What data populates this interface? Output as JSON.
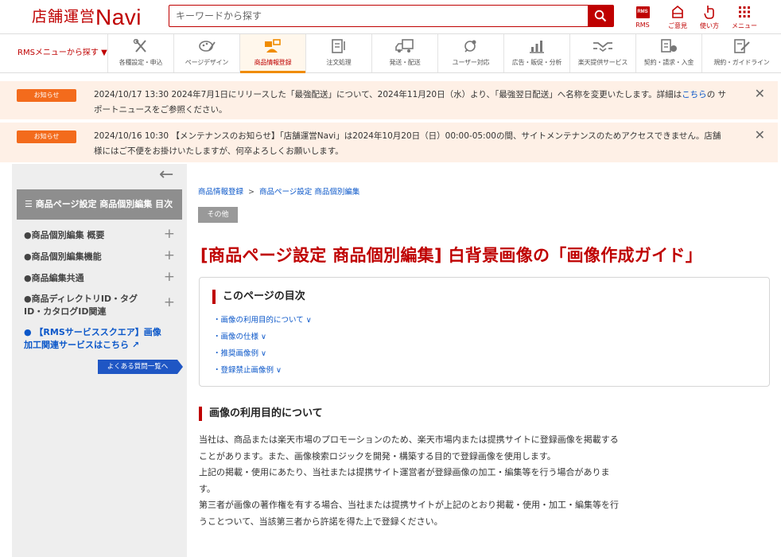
{
  "header": {
    "logo_jp": "店舗運営",
    "logo_navi": "Navi",
    "search_placeholder": "キーワードから探す",
    "icons": [
      {
        "name": "rms-icon",
        "label": "RMS"
      },
      {
        "name": "feedback-icon",
        "label": "ご意見"
      },
      {
        "name": "howto-icon",
        "label": "使い方"
      },
      {
        "name": "menu-grid-icon",
        "label": "メニュー"
      }
    ]
  },
  "menubar": {
    "rms_menu": "RMSメニューから探す ▼",
    "items": [
      {
        "label": "各種設定・申込",
        "icon": "tools-icon"
      },
      {
        "label": "ページデザイン",
        "icon": "design-icon"
      },
      {
        "label": "商品情報登録",
        "icon": "product-icon",
        "active": true
      },
      {
        "label": "注文処理",
        "icon": "order-icon"
      },
      {
        "label": "発送・配送",
        "icon": "shipping-icon"
      },
      {
        "label": "ユーザー対応",
        "icon": "user-support-icon"
      },
      {
        "label": "広告・販促・分析",
        "icon": "analytics-icon"
      },
      {
        "label": "楽天提供サービス",
        "icon": "service-icon"
      },
      {
        "label": "契約・請求・入金",
        "icon": "contract-icon"
      },
      {
        "label": "規約・ガイドライン",
        "icon": "guideline-icon"
      }
    ]
  },
  "notices": [
    {
      "badge": "お知らせ",
      "text_before": "2024/10/17 13:30  2024年7月1日にリリースした「最強配送」について、2024年11月20日（水）より、「最強翌日配送」へ名称を変更いたします。詳細は",
      "link": "こちら",
      "text_after": "の サポートニュースをご参照ください。"
    },
    {
      "badge": "お知らせ",
      "text_before": "2024/10/16 10:30 【メンテナンスのお知らせ】「店舗運営Navi」は2024年10月20日（日）00:00-05:00の間、サイトメンテナンスのためアクセスできません。店舗様にはご不便をお掛けいたしますが、何卒よろしくお願いします。",
      "link": "",
      "text_after": ""
    }
  ],
  "sidebar": {
    "toc_head": "☰ 商品ページ設定 商品個別編集 目次",
    "items": [
      {
        "label": "●商品個別編集 概要"
      },
      {
        "label": "●商品個別編集機能"
      },
      {
        "label": "●商品編集共通"
      },
      {
        "label": "●商品ディレクトリID・タグID・カタログID関連"
      },
      {
        "label": "● 【RMSサービススクエア】画像加工関連サービスはこちら ↗"
      }
    ],
    "faq_button": "よくある質問一覧へ"
  },
  "main": {
    "breadcrumb": [
      "商品情報登録",
      "商品ページ設定 商品個別編集"
    ],
    "breadcrumb_sep": ">",
    "tag": "その他",
    "title": "[商品ページ設定 商品個別編集] 白背景画像の「画像作成ガイド」",
    "toc": {
      "title": "このページの目次",
      "links": [
        "・画像の利用目的について ∨",
        "・画像の仕様 ∨",
        "・推奨画像例 ∨",
        "・登録禁止画像例 ∨"
      ]
    },
    "section_title": "画像の利用目的について",
    "paragraphs": [
      "当社は、商品または楽天市場のプロモーションのため、楽天市場内または提携サイトに登録画像を掲載することがあります。また、画像検索ロジックを開発・構築する目的で登録画像を使用します。",
      "上記の掲載・使用にあたり、当社または提携サイト運営者が登録画像の加工・編集等を行う場合があります。",
      "第三者が画像の著作権を有する場合、当社または提携サイトが上記のとおり掲載・使用・加工・編集等を行うことついて、当該第三者から許諾を得た上で登録ください。"
    ]
  },
  "colors": {
    "brand": "#bf0000",
    "notice_bg": "#fef0e6",
    "notice_badge": "#f36b1c",
    "link": "#0b57c9",
    "faq_button": "#1f56c4"
  }
}
